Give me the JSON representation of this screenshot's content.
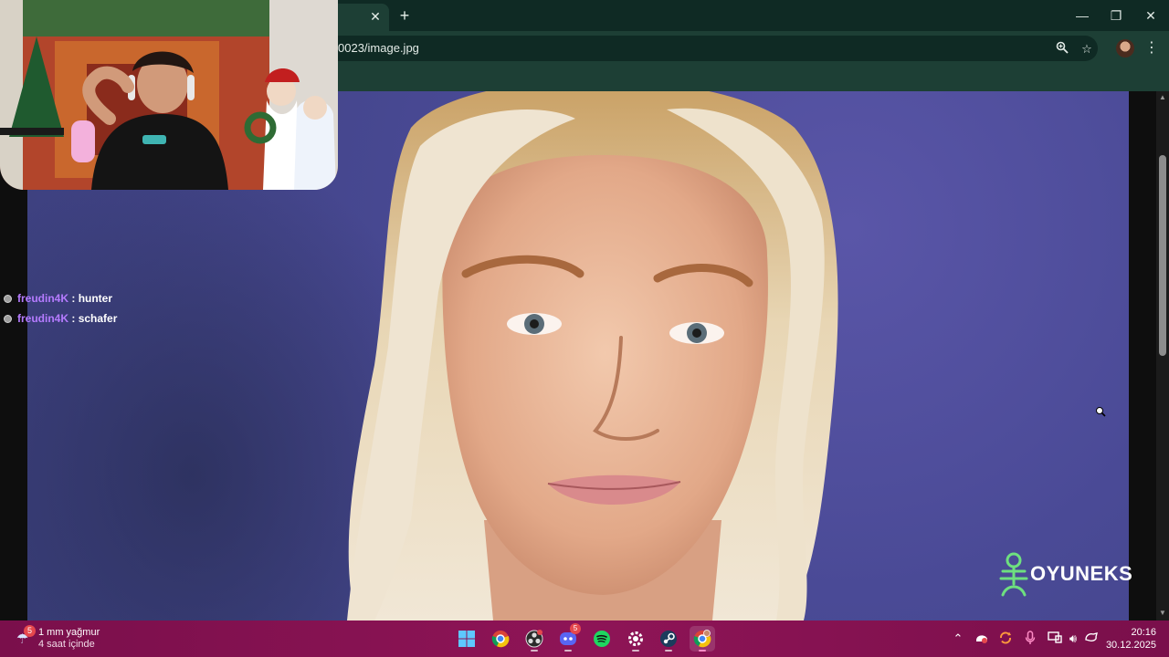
{
  "browser": {
    "tab_close_glyph": "✕",
    "new_tab_glyph": "+",
    "address_text": "0023/image.jpg",
    "window_controls": {
      "minimize": "—",
      "restore": "❐",
      "close": "✕"
    },
    "icons": [
      "zoom-icon",
      "bookmark-star-icon",
      "profile-avatar",
      "menu-kebab-icon"
    ]
  },
  "chat": {
    "messages": [
      {
        "user": "freudin4K",
        "separator": " : ",
        "text": "hunter"
      },
      {
        "user": "freudin4K",
        "separator": " : ",
        "text": "schafer"
      }
    ],
    "username_color": "#b57bff"
  },
  "watermark": {
    "text": "OYUNEKS",
    "color": "#6ee07f"
  },
  "taskbar": {
    "weather": {
      "badge": "5",
      "line1": "1 mm yağmur",
      "line2": "4 saat içinde"
    },
    "apps": [
      {
        "name": "start-button",
        "icon": "windows-logo-icon",
        "active": false,
        "badge": ""
      },
      {
        "name": "chrome",
        "icon": "chrome-icon",
        "active": false,
        "badge": ""
      },
      {
        "name": "obs",
        "icon": "obs-icon",
        "active": false,
        "badge": ""
      },
      {
        "name": "discord",
        "icon": "discord-icon",
        "active": false,
        "badge": "5"
      },
      {
        "name": "spotify",
        "icon": "spotify-icon",
        "active": false,
        "badge": ""
      },
      {
        "name": "steam-settings",
        "icon": "gear-icon",
        "active": false,
        "badge": ""
      },
      {
        "name": "steam",
        "icon": "steam-icon",
        "active": false,
        "badge": ""
      },
      {
        "name": "chrome-profile",
        "icon": "chrome-profile-icon",
        "active": true,
        "badge": ""
      }
    ],
    "clock": {
      "time": "20:16",
      "date": "30.12.2025"
    }
  },
  "colors": {
    "browser_frame": "#0f2a24",
    "browser_toolbar": "#1d3f35",
    "taskbar": "#8e1456",
    "photo_background": "#4a4a96"
  }
}
